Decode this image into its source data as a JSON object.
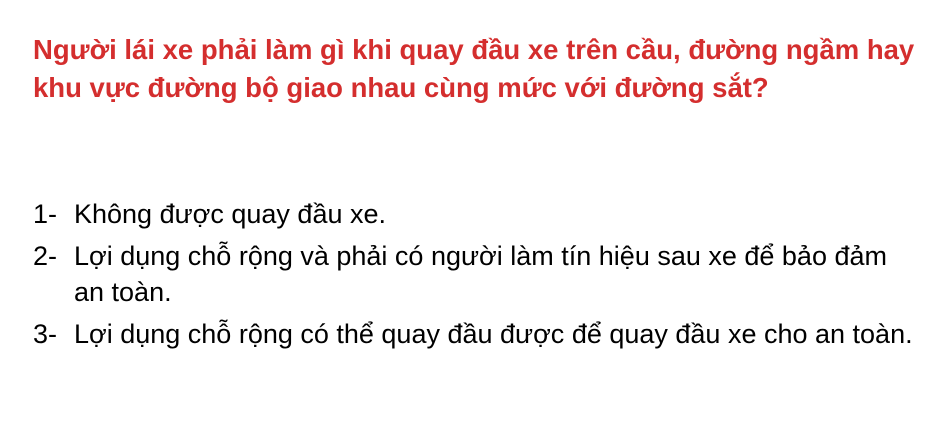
{
  "question": {
    "text": "Người lái xe phải làm gì khi quay đầu xe trên cầu, đường ngầm hay khu vực đường bộ giao nhau cùng mức với đường sắt?",
    "color": "#d42e2e"
  },
  "answers": [
    {
      "number": "1-",
      "text": "Không được quay đầu xe."
    },
    {
      "number": "2-",
      "text": "Lợi dụng chỗ rộng và phải có người làm tín hiệu sau xe để bảo đảm an toàn."
    },
    {
      "number": "3-",
      "text": "Lợi dụng chỗ rộng có thể quay đầu được để quay đầu xe cho an toàn."
    }
  ]
}
